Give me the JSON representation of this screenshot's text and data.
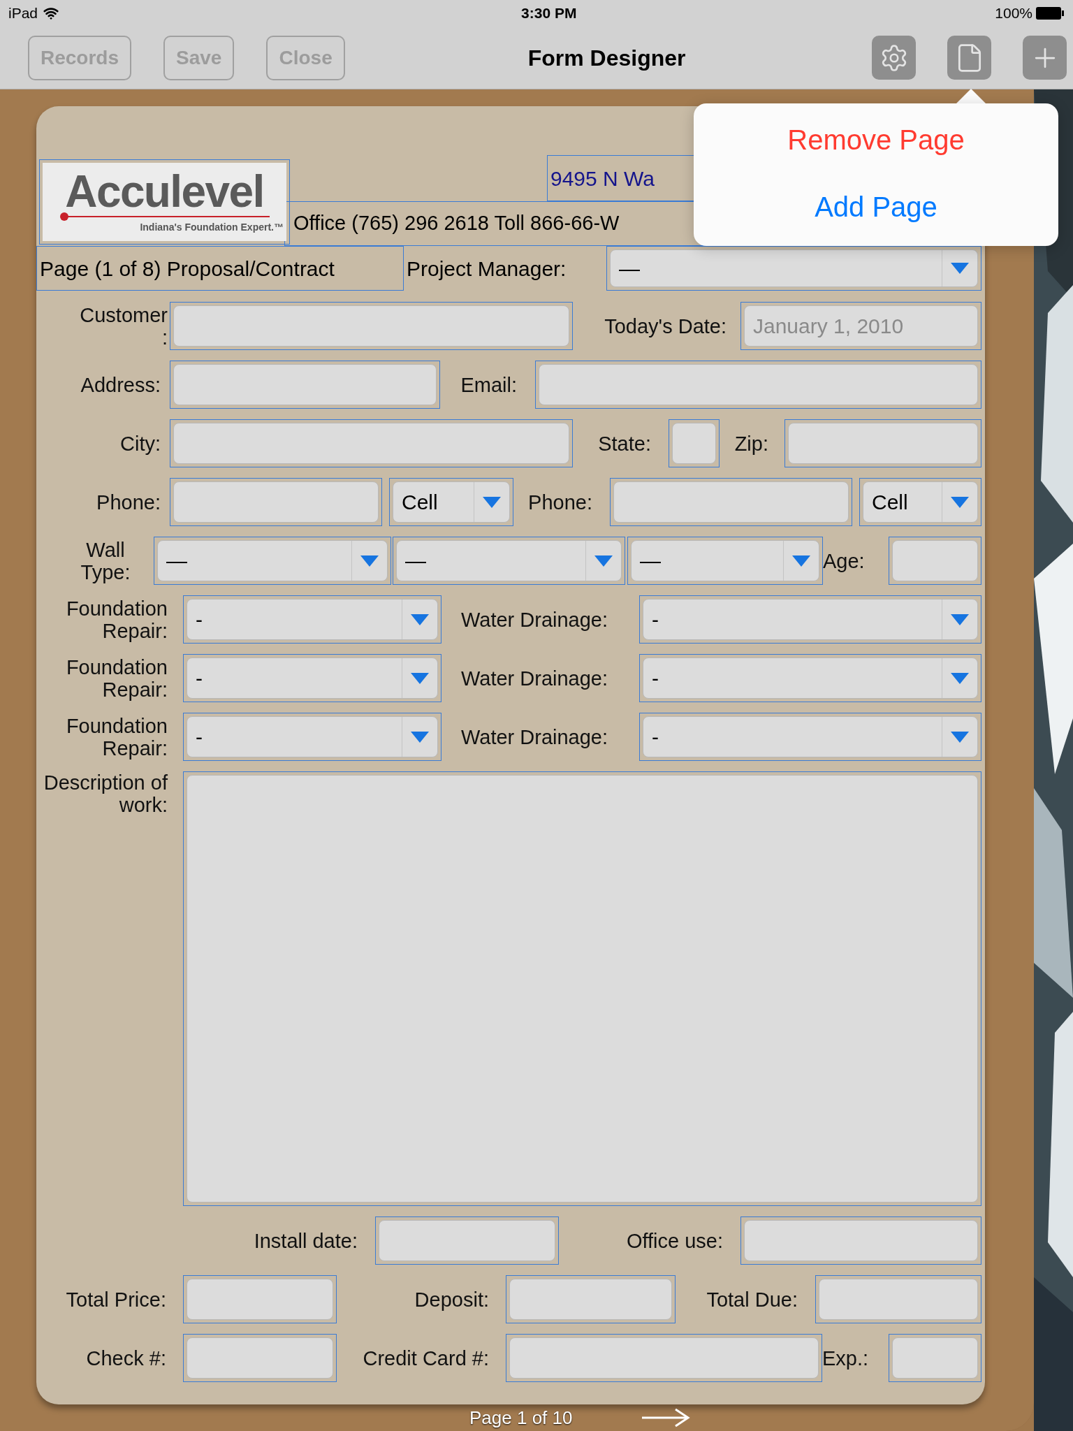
{
  "status_bar": {
    "device": "iPad",
    "time": "3:30 PM",
    "battery": "100%"
  },
  "toolbar": {
    "buttons": [
      {
        "label": "Records"
      },
      {
        "label": "Save"
      },
      {
        "label": "Close"
      }
    ],
    "title": "Form Designer"
  },
  "popover": {
    "items": [
      {
        "label": "Remove Page",
        "kind": "destructive"
      },
      {
        "label": "Add Page",
        "kind": "default"
      }
    ]
  },
  "form": {
    "logo": {
      "name": "Acculevel",
      "tagline": "Indiana's Foundation Expert.™"
    },
    "address": "9495 N Wa",
    "contact": "Office (765) 296 2618 Toll 866-66-W",
    "page_title": "Page (1 of 8) Proposal/Contract",
    "project_manager": {
      "label": "Project Manager:",
      "value": "—"
    },
    "rows": [
      {
        "items": [
          {
            "kind": "label",
            "text": "Customer :"
          },
          {
            "kind": "text"
          },
          {
            "kind": "label",
            "text": "Today's Date:"
          },
          {
            "kind": "date",
            "placeholder": "January 1, 2010"
          }
        ]
      },
      {
        "items": [
          {
            "kind": "label",
            "text": "Address:"
          },
          {
            "kind": "text"
          },
          {
            "kind": "label",
            "text": "Email:"
          },
          {
            "kind": "text"
          }
        ]
      },
      {
        "items": [
          {
            "kind": "label",
            "text": "City:"
          },
          {
            "kind": "text"
          },
          {
            "kind": "label",
            "text": "State:"
          },
          {
            "kind": "text"
          },
          {
            "kind": "label",
            "text": "Zip:"
          },
          {
            "kind": "text"
          }
        ]
      },
      {
        "items": [
          {
            "kind": "label",
            "text": "Phone:"
          },
          {
            "kind": "text"
          },
          {
            "kind": "dropdown",
            "value": "Cell"
          },
          {
            "kind": "label",
            "text": "Phone:"
          },
          {
            "kind": "text"
          },
          {
            "kind": "dropdown",
            "value": "Cell"
          }
        ]
      },
      {
        "items": [
          {
            "kind": "label",
            "text": "Wall Type:"
          },
          {
            "kind": "dropdown",
            "value": "—"
          },
          {
            "kind": "dropdown",
            "value": "—"
          },
          {
            "kind": "dropdown",
            "value": "—"
          },
          {
            "kind": "label",
            "text": "Age:"
          },
          {
            "kind": "text"
          }
        ]
      },
      {
        "items": [
          {
            "kind": "label",
            "text": "Foundation Repair:"
          },
          {
            "kind": "dropdown",
            "value": "-"
          },
          {
            "kind": "label",
            "text": "Water Drainage:"
          },
          {
            "kind": "dropdown",
            "value": "-"
          }
        ]
      },
      {
        "items": [
          {
            "kind": "label",
            "text": "Foundation Repair:"
          },
          {
            "kind": "dropdown",
            "value": "-"
          },
          {
            "kind": "label",
            "text": "Water Drainage:"
          },
          {
            "kind": "dropdown",
            "value": "-"
          }
        ]
      },
      {
        "items": [
          {
            "kind": "label",
            "text": "Foundation Repair:"
          },
          {
            "kind": "dropdown",
            "value": "-"
          },
          {
            "kind": "label",
            "text": "Water Drainage:"
          },
          {
            "kind": "dropdown",
            "value": "-"
          }
        ]
      },
      {
        "items": [
          {
            "kind": "label",
            "text": "Description of work:"
          },
          {
            "kind": "textarea"
          }
        ]
      },
      {
        "items": [
          {
            "kind": "label",
            "text": "Install date:"
          },
          {
            "kind": "text"
          },
          {
            "kind": "label",
            "text": "Office use:"
          },
          {
            "kind": "text"
          }
        ]
      },
      {
        "items": [
          {
            "kind": "label",
            "text": "Total Price:"
          },
          {
            "kind": "text"
          },
          {
            "kind": "label",
            "text": "Deposit:"
          },
          {
            "kind": "text"
          },
          {
            "kind": "label",
            "text": "Total Due:"
          },
          {
            "kind": "text"
          }
        ]
      },
      {
        "items": [
          {
            "kind": "label",
            "text": "Check #:"
          },
          {
            "kind": "text"
          },
          {
            "kind": "label",
            "text": "Credit Card #:"
          },
          {
            "kind": "text"
          },
          {
            "kind": "label",
            "text": "Exp.:"
          },
          {
            "kind": "text"
          }
        ]
      }
    ]
  },
  "pager": {
    "label": "Page 1 of 10"
  }
}
